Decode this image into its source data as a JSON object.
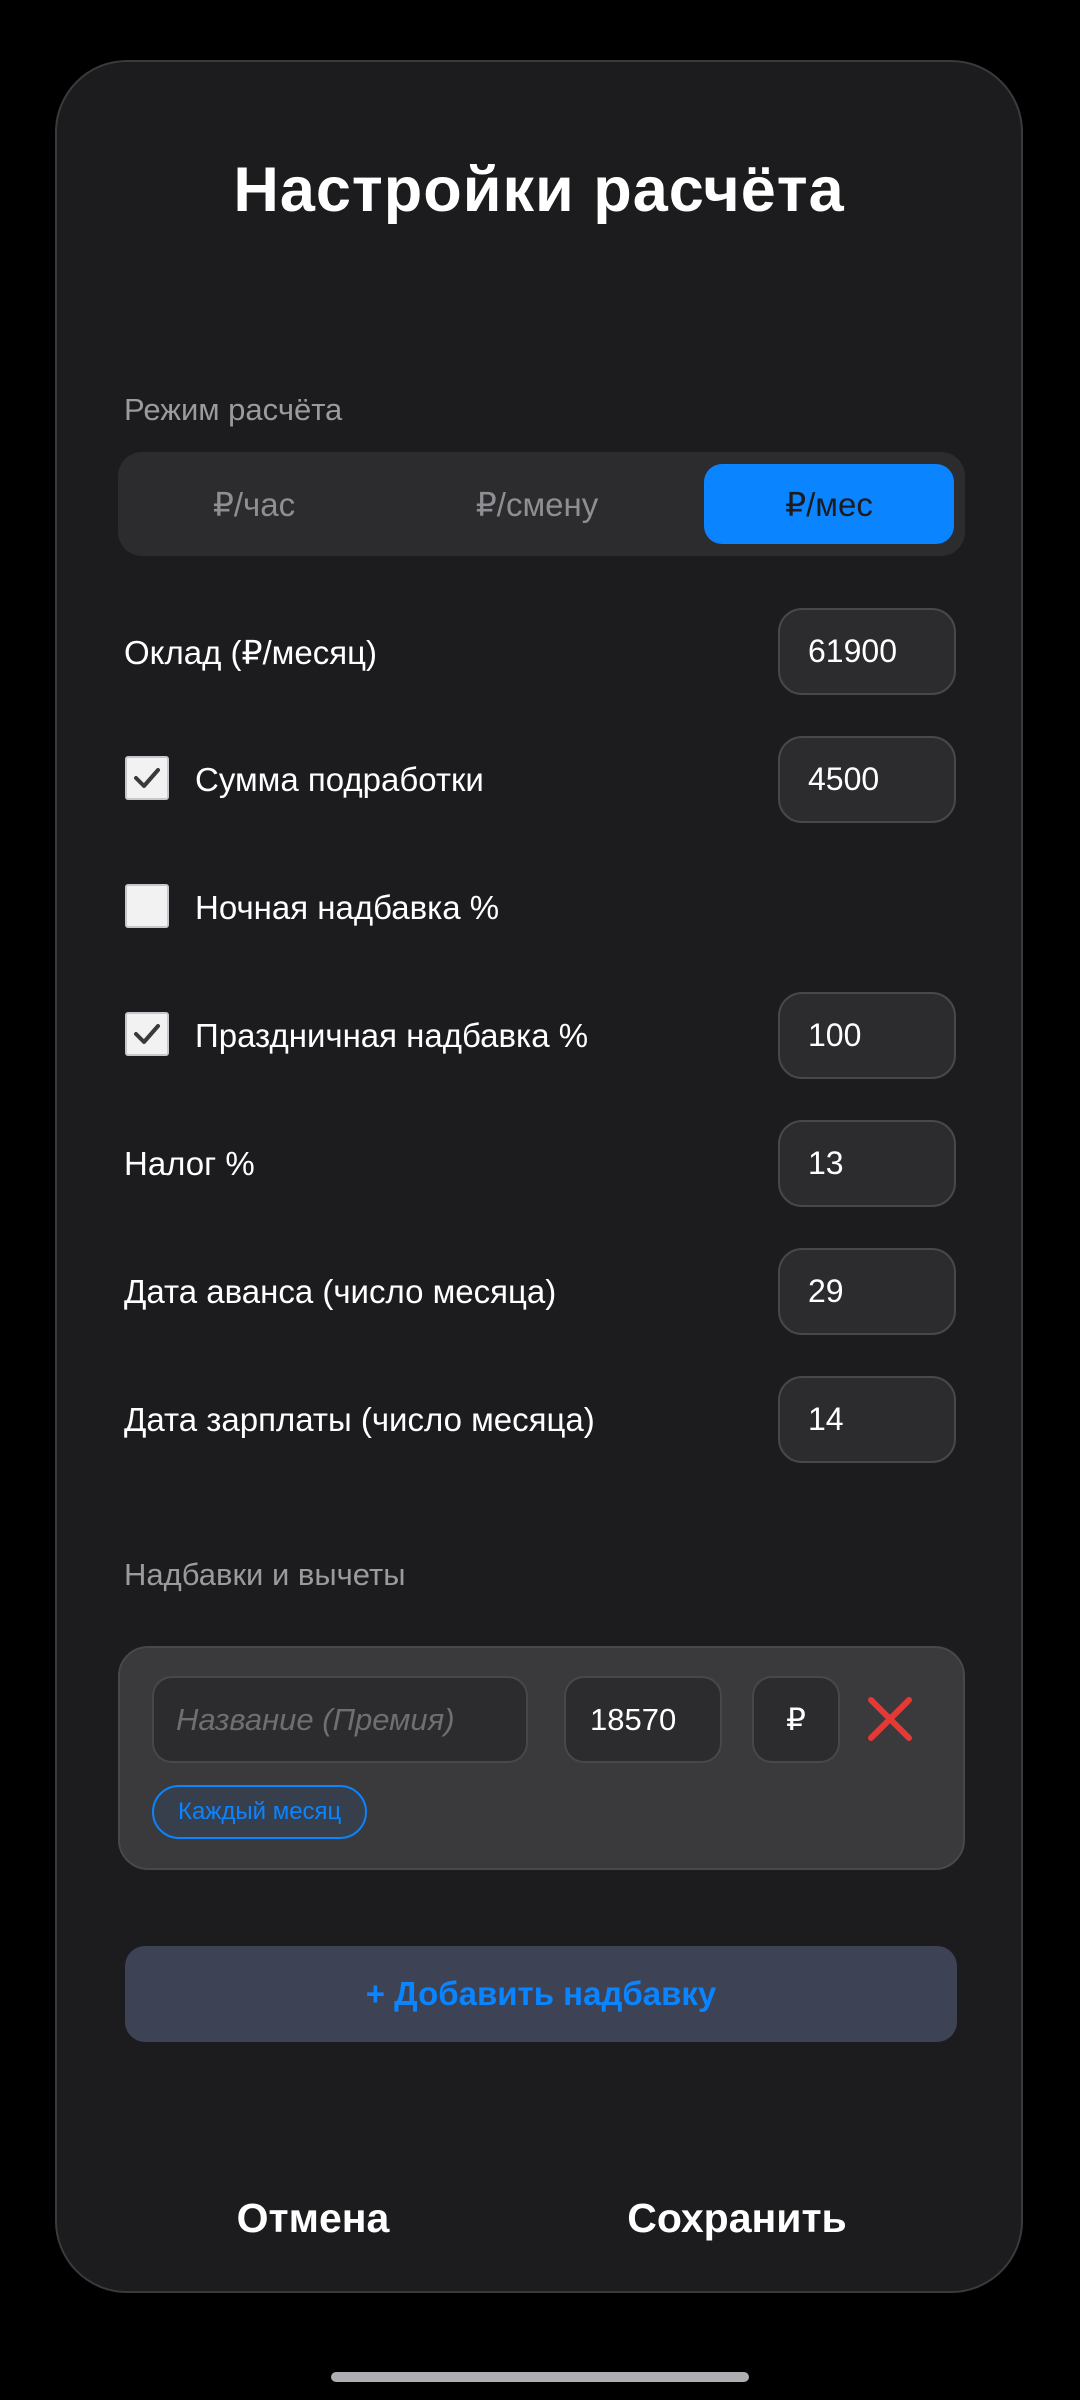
{
  "dialog": {
    "title": "Настройки расчёта",
    "mode_label": "Режим расчёта",
    "modes": [
      {
        "label": "₽/час",
        "active": false
      },
      {
        "label": "₽/смену",
        "active": false
      },
      {
        "label": "₽/мес",
        "active": true
      }
    ],
    "fields": {
      "salary": {
        "label": "Оклад (₽/месяц)",
        "value": "61900"
      },
      "overtime": {
        "label": "Сумма подработки",
        "value": "4500",
        "checked": true
      },
      "night": {
        "label": "Ночная надбавка %",
        "checked": false
      },
      "holiday": {
        "label": "Праздничная надбавка %",
        "value": "100",
        "checked": true
      },
      "tax": {
        "label": "Налог %",
        "value": "13"
      },
      "advance_date": {
        "label": "Дата аванса (число месяца)",
        "value": "29"
      },
      "salary_date": {
        "label": "Дата зарплаты (число месяца)",
        "value": "14"
      }
    },
    "allowances_label": "Надбавки и вычеты",
    "allowance": {
      "name_placeholder": "Название (Премия)",
      "amount": "18570",
      "currency": "₽",
      "frequency": "Каждый месяц"
    },
    "add_label": "+ Добавить надбавку",
    "cancel_label": "Отмена",
    "save_label": "Сохранить"
  },
  "colors": {
    "accent": "#0a84ff",
    "delete": "#e53935",
    "sheet_bg": "#1c1c1e"
  }
}
